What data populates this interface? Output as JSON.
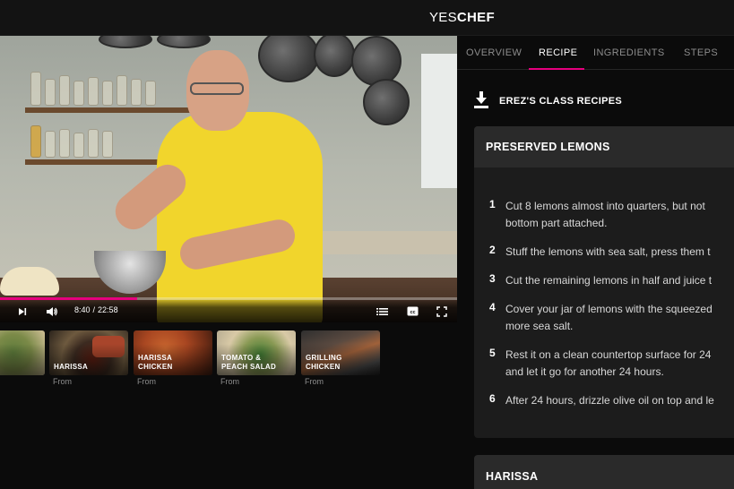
{
  "brand": {
    "light": "YES",
    "bold": "CHEF"
  },
  "video": {
    "current_time": "8:40",
    "separator": "/",
    "duration": "22:58",
    "progress_fraction": 0.3,
    "accent": "#e6007e",
    "icons": [
      "next-icon",
      "volume-icon",
      "list-icon",
      "cc-icon",
      "fullscreen-icon"
    ]
  },
  "carousel": [
    {
      "title": "",
      "sub": ""
    },
    {
      "title": "HARISSA",
      "sub": "From"
    },
    {
      "title": "HARISSA CHICKEN",
      "sub": "From"
    },
    {
      "title": "TOMATO & PEACH SALAD",
      "sub": "From"
    },
    {
      "title": "GRILLING CHICKEN",
      "sub": "From"
    }
  ],
  "tabs": [
    {
      "label": "OVERVIEW",
      "active": false
    },
    {
      "label": "RECIPE",
      "active": true
    },
    {
      "label": "INGREDIENTS",
      "active": false
    },
    {
      "label": "STEPS",
      "active": false
    }
  ],
  "download": {
    "label": "EREZ'S CLASS RECIPES",
    "icon": "download-icon"
  },
  "recipes": [
    {
      "title": "PRESERVED LEMONS",
      "steps": [
        {
          "num": "1",
          "lines": [
            "Cut 8 lemons almost into quarters, but not",
            "bottom part attached."
          ]
        },
        {
          "num": "2",
          "lines": [
            "Stuff the lemons with sea salt, press them t"
          ]
        },
        {
          "num": "3",
          "lines": [
            "Cut the remaining lemons in half and juice t"
          ]
        },
        {
          "num": "4",
          "lines": [
            "Cover your jar of lemons with the squeezed",
            "more sea salt."
          ]
        },
        {
          "num": "5",
          "lines": [
            "Rest it on a clean countertop surface for 24",
            "and let it go for another 24 hours."
          ]
        },
        {
          "num": "6",
          "lines": [
            "After 24 hours, drizzle olive oil on top and le"
          ]
        }
      ]
    },
    {
      "title": "HARISSA"
    }
  ]
}
